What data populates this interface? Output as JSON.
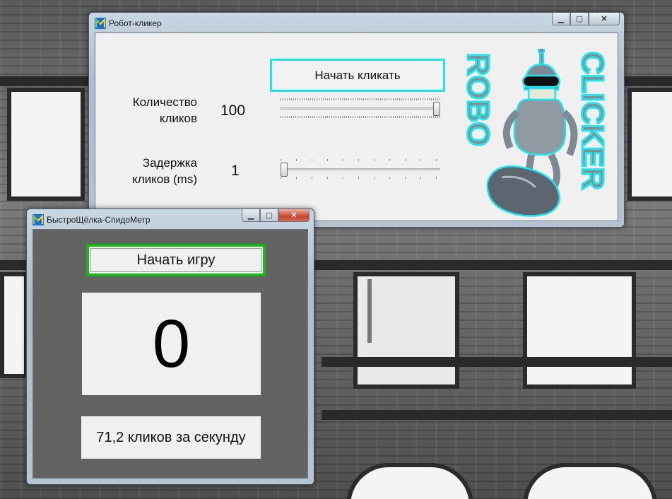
{
  "robot_window": {
    "title": "Робот-кликер",
    "start_button": "Начать кликать",
    "click_count_label_line1": "Количество",
    "click_count_label_line2": "кликов",
    "click_count_value": "100",
    "click_count_slider_fraction": 1.0,
    "delay_label_line1": "Задержка",
    "delay_label_line2": "кликов (ms)",
    "delay_value": "1",
    "delay_slider_fraction": 0.0,
    "logo_word_left": "ROBO",
    "logo_word_right": "CLICKER"
  },
  "speed_window": {
    "title": "БыстроЩёлка-СпидоМетр",
    "start_button": "Начать игру",
    "score": "0",
    "rate_text": "71,2 кликов за секунду"
  },
  "colors": {
    "start_button_border": "#22e4ee",
    "game_button_border": "#19b619",
    "speed_client_bg": "#636363",
    "logo_stroke": "#22e4ee"
  }
}
